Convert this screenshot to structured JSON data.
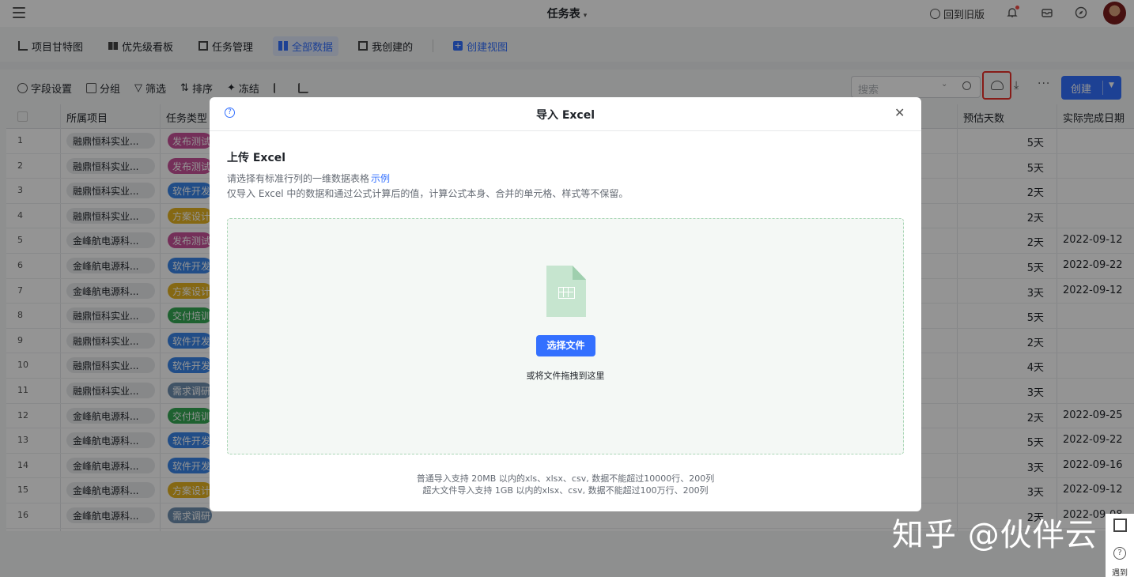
{
  "app": {
    "title": "任务表",
    "back_to_old": "回到旧版"
  },
  "view_tabs": [
    {
      "label": "项目甘特图"
    },
    {
      "label": "优先级看板"
    },
    {
      "label": "任务管理"
    },
    {
      "label": "全部数据",
      "active": true
    },
    {
      "label": "我创建的"
    },
    {
      "label": "创建视图"
    }
  ],
  "toolbar": {
    "field_settings": "字段设置",
    "group": "分组",
    "filter": "筛选",
    "sort": "排序",
    "freeze": "冻结",
    "search_placeholder": "搜索",
    "create": "创建"
  },
  "table": {
    "columns": [
      "所属项目",
      "任务类型",
      "预估天数",
      "实际完成日期"
    ],
    "rows": [
      {
        "n": "1",
        "project": "融鼎恒科实业...",
        "type": "发布测试",
        "type_color": "#c9519a",
        "days": "5天",
        "done": ""
      },
      {
        "n": "2",
        "project": "融鼎恒科实业...",
        "type": "发布测试",
        "type_color": "#c9519a",
        "days": "5天",
        "done": ""
      },
      {
        "n": "3",
        "project": "融鼎恒科实业...",
        "type": "软件开发",
        "type_color": "#3a86e8",
        "days": "2天",
        "done": ""
      },
      {
        "n": "4",
        "project": "融鼎恒科实业...",
        "type": "方案设计",
        "type_color": "#e6b422",
        "days": "2天",
        "done": ""
      },
      {
        "n": "5",
        "project": "金峰航电源科...",
        "type": "发布测试",
        "type_color": "#c9519a",
        "days": "2天",
        "done": "2022-09-12"
      },
      {
        "n": "6",
        "project": "金峰航电源科...",
        "type": "软件开发",
        "type_color": "#3a86e8",
        "days": "5天",
        "done": "2022-09-22"
      },
      {
        "n": "7",
        "project": "金峰航电源科...",
        "type": "方案设计",
        "type_color": "#e6b422",
        "days": "3天",
        "done": "2022-09-12"
      },
      {
        "n": "8",
        "project": "融鼎恒科实业...",
        "type": "交付培训",
        "type_color": "#34a853",
        "days": "5天",
        "done": ""
      },
      {
        "n": "9",
        "project": "融鼎恒科实业...",
        "type": "软件开发",
        "type_color": "#3a86e8",
        "days": "2天",
        "done": ""
      },
      {
        "n": "10",
        "project": "融鼎恒科实业...",
        "type": "软件开发",
        "type_color": "#3a86e8",
        "days": "4天",
        "done": ""
      },
      {
        "n": "11",
        "project": "融鼎恒科实业...",
        "type": "需求调研",
        "type_color": "#6f8fb0",
        "days": "3天",
        "done": ""
      },
      {
        "n": "12",
        "project": "金峰航电源科...",
        "type": "交付培训",
        "type_color": "#34a853",
        "days": "2天",
        "done": "2022-09-25"
      },
      {
        "n": "13",
        "project": "金峰航电源科...",
        "type": "软件开发",
        "type_color": "#3a86e8",
        "days": "5天",
        "done": "2022-09-22"
      },
      {
        "n": "14",
        "project": "金峰航电源科...",
        "type": "软件开发",
        "type_color": "#3a86e8",
        "days": "3天",
        "done": "2022-09-16"
      },
      {
        "n": "15",
        "project": "金峰航电源科...",
        "type": "方案设计",
        "type_color": "#e6b422",
        "days": "3天",
        "done": "2022-09-12"
      },
      {
        "n": "16",
        "project": "金峰航电源科...",
        "type": "需求调研",
        "type_color": "#6f8fb0",
        "days": "2天",
        "done": "2022-09-08"
      }
    ]
  },
  "modal": {
    "title": "导入 Excel",
    "section_title": "上传 Excel",
    "desc_line1": "请选择有标准行列的一维数据表格",
    "example_link": "示例",
    "desc_line2": "仅导入 Excel 中的数据和通过公式计算后的值，计算公式本身、合并的单元格、样式等不保留。",
    "choose_file": "选择文件",
    "drag_hint": "或将文件拖拽到这里",
    "note1": "普通导入支持 20MB 以内的xls、xlsx、csv, 数据不能超过10000行、200列",
    "note2": "超大文件导入支持 1GB 以内的xlsx、csv, 数据不能超过100万行、200列"
  },
  "watermark": "知乎 @伙伴云",
  "side": {
    "meet": "遇到"
  },
  "colors": {
    "accent": "#3370ff",
    "highlight_border": "#e8312a"
  }
}
